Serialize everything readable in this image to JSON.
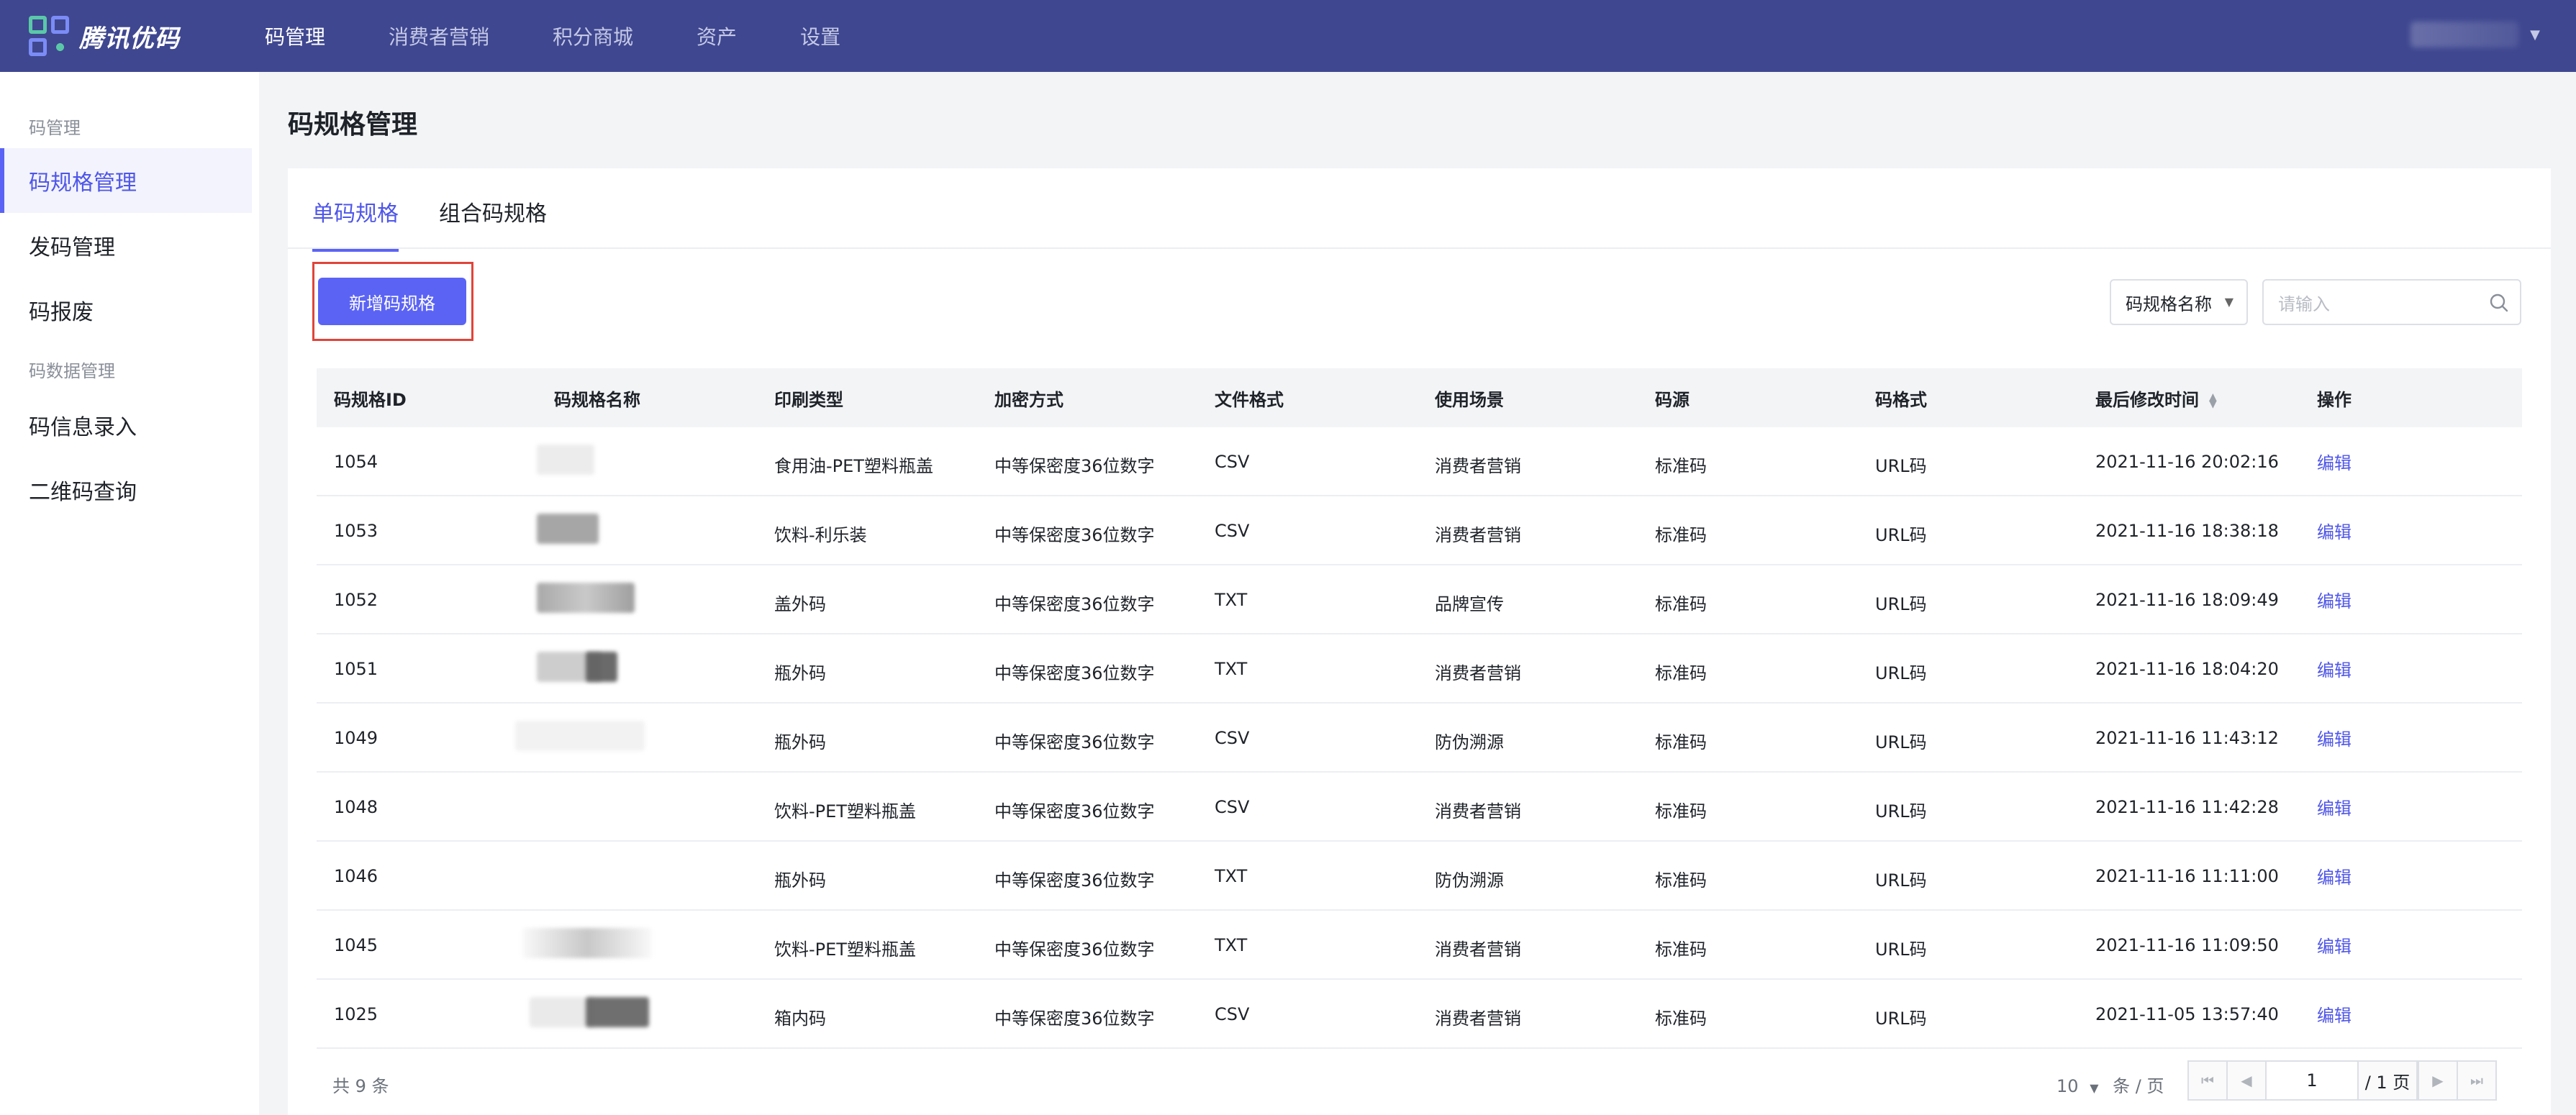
{
  "brand": {
    "name": "腾讯优码"
  },
  "topnav": [
    {
      "label": "码管理",
      "active": true
    },
    {
      "label": "消费者营销"
    },
    {
      "label": "积分商城"
    },
    {
      "label": "资产"
    },
    {
      "label": "设置"
    }
  ],
  "user": {
    "caret_icon": "caret-down-icon"
  },
  "sidebar": {
    "group1": "码管理",
    "items_group1": [
      "码规格管理",
      "发码管理",
      "码报废"
    ],
    "group2": "码数据管理",
    "items_group2": [
      "码信息录入",
      "二维码查询"
    ]
  },
  "page": {
    "title": "码规格管理"
  },
  "tabs": [
    "单码规格",
    "组合码规格"
  ],
  "toolbar": {
    "add_label": "新增码规格",
    "filter_label": "码规格名称",
    "search_placeholder": "请输入"
  },
  "table": {
    "headers": [
      "码规格ID",
      "码规格名称",
      "印刷类型",
      "加密方式",
      "文件格式",
      "使用场景",
      "码源",
      "码格式",
      "最后修改时间",
      "操作"
    ],
    "rows": [
      {
        "id": "1054",
        "print": "食用油-PET塑料瓶盖",
        "enc": "中等保密度36位数字",
        "fmt": "CSV",
        "scene": "消费者营销",
        "src": "标准码",
        "code": "URL码",
        "time": "2021-11-16 20:02:16",
        "op": "编辑"
      },
      {
        "id": "1053",
        "print": "饮料-利乐装",
        "enc": "中等保密度36位数字",
        "fmt": "CSV",
        "scene": "消费者营销",
        "src": "标准码",
        "code": "URL码",
        "time": "2021-11-16 18:38:18",
        "op": "编辑"
      },
      {
        "id": "1052",
        "print": "盖外码",
        "enc": "中等保密度36位数字",
        "fmt": "TXT",
        "scene": "品牌宣传",
        "src": "标准码",
        "code": "URL码",
        "time": "2021-11-16 18:09:49",
        "op": "编辑"
      },
      {
        "id": "1051",
        "print": "瓶外码",
        "enc": "中等保密度36位数字",
        "fmt": "TXT",
        "scene": "消费者营销",
        "src": "标准码",
        "code": "URL码",
        "time": "2021-11-16 18:04:20",
        "op": "编辑"
      },
      {
        "id": "1049",
        "print": "瓶外码",
        "enc": "中等保密度36位数字",
        "fmt": "CSV",
        "scene": "防伪溯源",
        "src": "标准码",
        "code": "URL码",
        "time": "2021-11-16 11:43:12",
        "op": "编辑"
      },
      {
        "id": "1048",
        "print": "饮料-PET塑料瓶盖",
        "enc": "中等保密度36位数字",
        "fmt": "CSV",
        "scene": "消费者营销",
        "src": "标准码",
        "code": "URL码",
        "time": "2021-11-16 11:42:28",
        "op": "编辑"
      },
      {
        "id": "1046",
        "print": "瓶外码",
        "enc": "中等保密度36位数字",
        "fmt": "TXT",
        "scene": "防伪溯源",
        "src": "标准码",
        "code": "URL码",
        "time": "2021-11-16 11:11:00",
        "op": "编辑"
      },
      {
        "id": "1045",
        "print": "饮料-PET塑料瓶盖",
        "enc": "中等保密度36位数字",
        "fmt": "TXT",
        "scene": "消费者营销",
        "src": "标准码",
        "code": "URL码",
        "time": "2021-11-16 11:09:50",
        "op": "编辑"
      },
      {
        "id": "1025",
        "print": "箱内码",
        "enc": "中等保密度36位数字",
        "fmt": "CSV",
        "scene": "消费者营销",
        "src": "标准码",
        "code": "URL码",
        "time": "2021-11-05 13:57:40",
        "op": "编辑"
      }
    ]
  },
  "footer": {
    "total": "共 9 条",
    "page_size": "10",
    "page_size_unit": "条 / 页",
    "current_page": "1",
    "total_pages": "/ 1 页"
  },
  "colors": {
    "topbar": "#3f4790",
    "accent": "#5b63f5",
    "highlight_box": "#e0443a"
  }
}
